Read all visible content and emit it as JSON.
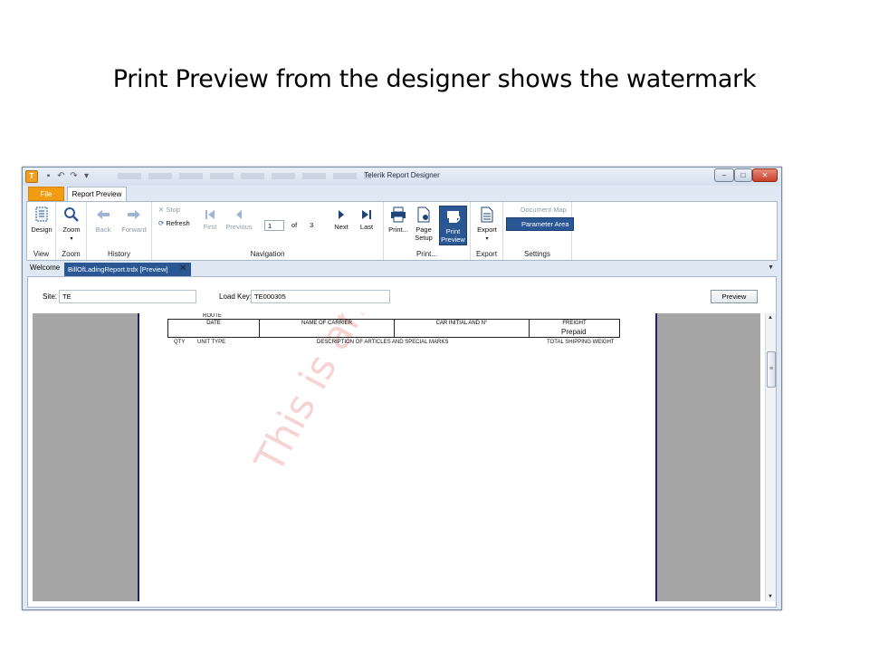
{
  "slide": {
    "title": "Print Preview from the designer shows the watermark"
  },
  "window": {
    "title": "Telerik Report Designer",
    "minimize": "–",
    "maximize": "□",
    "close": "✕"
  },
  "ribbon_tabs": {
    "file": "File",
    "report_preview": "Report Preview"
  },
  "ribbon": {
    "view": {
      "label": "View",
      "design": "Design"
    },
    "zoom": {
      "label": "Zoom",
      "zoom": "Zoom"
    },
    "history": {
      "label": "History",
      "back": "Back",
      "forward": "Forward"
    },
    "navigation": {
      "label": "Navigation",
      "stop": "Stop",
      "refresh": "Refresh",
      "first": "First",
      "previous": "Previous",
      "current_page": "1",
      "of": "of",
      "total_pages": "3",
      "next": "Next",
      "last": "Last"
    },
    "print": {
      "label": "Print...",
      "print": "Print...",
      "page_setup_1": "Page",
      "page_setup_2": "Setup",
      "print_preview_1": "Print",
      "print_preview_2": "Preview"
    },
    "export": {
      "label": "Export",
      "export": "Export"
    },
    "settings": {
      "label": "Settings",
      "document_map": "Document Map",
      "parameter_area": "Parameter Area"
    }
  },
  "doc_tabs": {
    "welcome": "Welcome",
    "active": "BillOfLadingReport.trdx [Preview]",
    "close": "✕"
  },
  "params": {
    "site_label": "Site:",
    "site_value": "TE",
    "load_key_label": "Load Key:",
    "load_key_value": "TE000305",
    "preview_button": "Preview"
  },
  "report": {
    "route": "ROUTE",
    "headers": [
      "DATE",
      "NAME OF CARRIER",
      "CAR INITIAL AND N°",
      "FREIGHT"
    ],
    "prepaid": "Prepaid",
    "columns": [
      "QTY",
      "UNIT TYPE",
      "DESCRIPTION OF ARTICLES AND SPECIAL MARKS",
      "TOTAL SHIPPING WEIGHT"
    ],
    "watermark": "This is another te"
  },
  "colors": {
    "accent": "#2a5694",
    "file_tab": "#f39c12",
    "watermark": "#dc3c3c"
  }
}
